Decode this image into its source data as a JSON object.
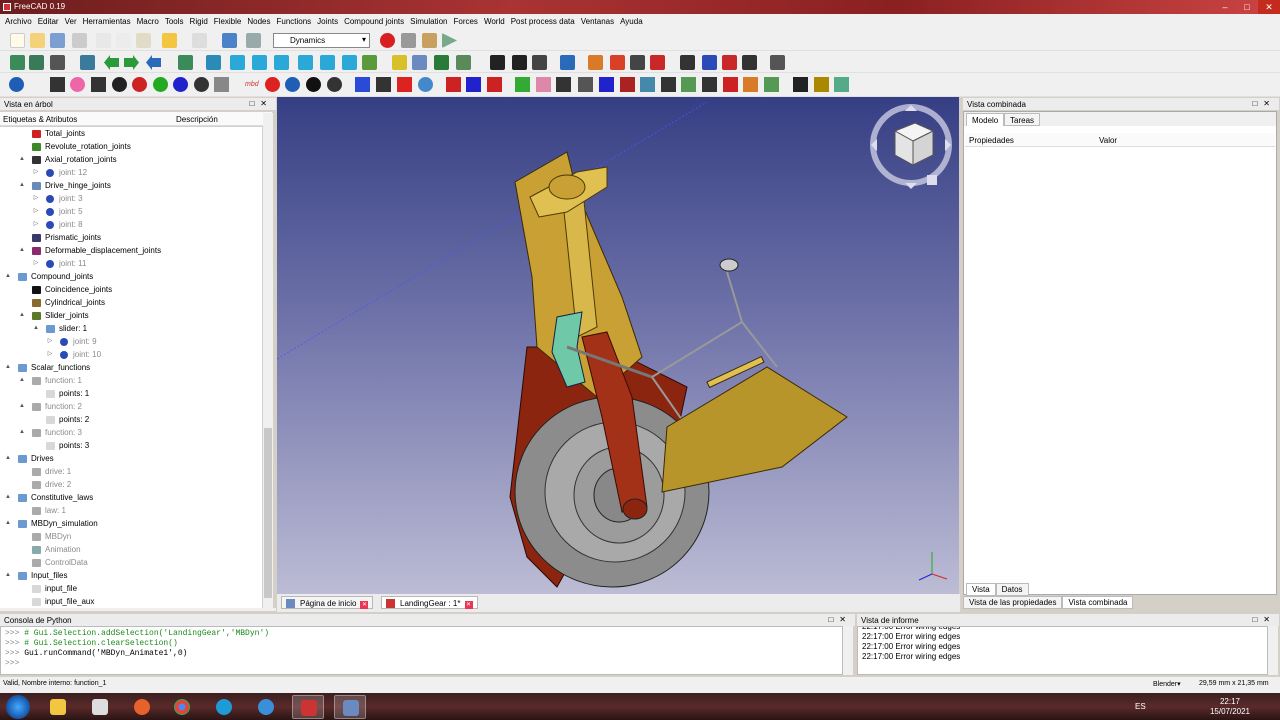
{
  "window": {
    "title": "FreeCAD 0.19"
  },
  "menu": [
    "Archivo",
    "Editar",
    "Ver",
    "Herramientas",
    "Macro",
    "Tools",
    "Rigid",
    "Flexible",
    "Nodes",
    "Functions",
    "Joints",
    "Compound joints",
    "Simulation",
    "Forces",
    "World",
    "Post process data",
    "Ventanas",
    "Ayuda"
  ],
  "toolbar": {
    "workbench": "Dynamics",
    "mbd_label": "mbd"
  },
  "tree_panel": {
    "title": "Vista en árbol",
    "col_labels": "Etiquetas & Atributos",
    "col_desc": "Descripción",
    "rows": [
      {
        "label": "Total_joints",
        "level": 3,
        "icon": "T",
        "arrow": "",
        "grey": false
      },
      {
        "label": "Revolute_rotation_joints",
        "level": 3,
        "icon": "green",
        "arrow": "",
        "grey": false
      },
      {
        "label": "Axial_rotation_joints",
        "level": 3,
        "icon": "dark",
        "arrow": "▲",
        "grey": false
      },
      {
        "label": "joint: 12",
        "level": 4,
        "icon": "joint",
        "arrow": "▷",
        "grey": true
      },
      {
        "label": "Drive_hinge_joints",
        "level": 3,
        "icon": "hinge",
        "arrow": "▲",
        "grey": false
      },
      {
        "label": "joint: 3",
        "level": 4,
        "icon": "joint",
        "arrow": "▷",
        "grey": true
      },
      {
        "label": "joint: 5",
        "level": 4,
        "icon": "joint",
        "arrow": "▷",
        "grey": true
      },
      {
        "label": "joint: 8",
        "level": 4,
        "icon": "joint",
        "arrow": "▷",
        "grey": true
      },
      {
        "label": "Prismatic_joints",
        "level": 3,
        "icon": "prism",
        "arrow": "",
        "grey": false
      },
      {
        "label": "Deformable_displacement_joints",
        "level": 3,
        "icon": "deform",
        "arrow": "▲",
        "grey": false
      },
      {
        "label": "joint: 11",
        "level": 4,
        "icon": "joint",
        "arrow": "▷",
        "grey": true
      },
      {
        "label": "Compound_joints",
        "level": 2,
        "icon": "folder",
        "arrow": "▲",
        "grey": false
      },
      {
        "label": "Coincidence_joints",
        "level": 3,
        "icon": "lock",
        "arrow": "",
        "grey": false
      },
      {
        "label": "Cylindrical_joints",
        "level": 3,
        "icon": "cyl",
        "arrow": "",
        "grey": false
      },
      {
        "label": "Slider_joints",
        "level": 3,
        "icon": "slider",
        "arrow": "▲",
        "grey": false
      },
      {
        "label": "slider: 1",
        "level": 4,
        "icon": "folder",
        "arrow": "▲",
        "grey": false
      },
      {
        "label": "joint: 9",
        "level": 5,
        "icon": "joint",
        "arrow": "▷",
        "grey": true
      },
      {
        "label": "joint: 10",
        "level": 5,
        "icon": "joint",
        "arrow": "▷",
        "grey": true
      },
      {
        "label": "Scalar_functions",
        "level": 2,
        "icon": "folder",
        "arrow": "▲",
        "grey": false
      },
      {
        "label": "function: 1",
        "level": 3,
        "icon": "fx",
        "arrow": "▲",
        "grey": true
      },
      {
        "label": "points: 1",
        "level": 4,
        "icon": "doc",
        "arrow": "",
        "grey": false
      },
      {
        "label": "function: 2",
        "level": 3,
        "icon": "fx",
        "arrow": "▲",
        "grey": true
      },
      {
        "label": "points: 2",
        "level": 4,
        "icon": "doc",
        "arrow": "",
        "grey": false
      },
      {
        "label": "function: 3",
        "level": 3,
        "icon": "fx",
        "arrow": "▲",
        "grey": true
      },
      {
        "label": "points: 3",
        "level": 4,
        "icon": "doc",
        "arrow": "",
        "grey": false
      },
      {
        "label": "Drives",
        "level": 2,
        "icon": "folder",
        "arrow": "▲",
        "grey": false
      },
      {
        "label": "drive: 1",
        "level": 3,
        "icon": "drive",
        "arrow": "",
        "grey": true
      },
      {
        "label": "drive: 2",
        "level": 3,
        "icon": "drive",
        "arrow": "",
        "grey": true
      },
      {
        "label": "Constitutive_laws",
        "level": 2,
        "icon": "folder",
        "arrow": "▲",
        "grey": false
      },
      {
        "label": "law: 1",
        "level": 3,
        "icon": "law",
        "arrow": "",
        "grey": true
      },
      {
        "label": "MBDyn_simulation",
        "level": 2,
        "icon": "folder",
        "arrow": "▲",
        "grey": false
      },
      {
        "label": "MBDyn",
        "level": 3,
        "icon": "mbdyn",
        "arrow": "",
        "grey": true
      },
      {
        "label": "Animation",
        "level": 3,
        "icon": "anim",
        "arrow": "",
        "grey": true
      },
      {
        "label": "ControlData",
        "level": 3,
        "icon": "ctrl",
        "arrow": "",
        "grey": true
      },
      {
        "label": "Input_files",
        "level": 2,
        "icon": "folder",
        "arrow": "▲",
        "grey": false
      },
      {
        "label": "input_file",
        "level": 3,
        "icon": "doc",
        "arrow": "",
        "grey": false
      },
      {
        "label": "input_file_aux",
        "level": 3,
        "icon": "doc",
        "arrow": "",
        "grey": false
      }
    ]
  },
  "doc_tabs": [
    {
      "label": "Página de inicio",
      "active": false
    },
    {
      "label": "LandingGear : 1*",
      "active": true
    }
  ],
  "combo_panel": {
    "title": "Vista combinada",
    "tabs": [
      "Modelo",
      "Tareas"
    ],
    "prop_col": "Propiedades",
    "val_col": "Valor",
    "view_tabs": [
      "Vista",
      "Datos"
    ],
    "bottom_tabs": [
      "Vista de las propiedades",
      "Vista combinada"
    ]
  },
  "python_console": {
    "title": "Consola de Python",
    "lines": [
      {
        "prompt": ">>> ",
        "text": "# Gui.Selection.addSelection('LandingGear','MBDyn')",
        "type": "comment"
      },
      {
        "prompt": ">>> ",
        "text": "# Gui.Selection.clearSelection()",
        "type": "comment"
      },
      {
        "prompt": ">>> ",
        "text": "Gui.runCommand('MBDyn_Animate1',0)",
        "type": "code"
      },
      {
        "prompt": ">>> ",
        "text": "",
        "type": "code"
      }
    ]
  },
  "report_view": {
    "title": "Vista de informe",
    "lines": [
      "22:17:00  Error wiring edges",
      "22:17:00  Error wiring edges",
      "22:17:00  Error wiring edges",
      "22:17:00  Error wiring edges"
    ]
  },
  "status": {
    "left": "Valid, Nombre interno: function_1",
    "nav": "Blender",
    "dims": "29,59 mm x 21,35 mm"
  },
  "taskbar": {
    "lang": "ES",
    "time": "22:17",
    "date": "15/07/2021"
  },
  "colors": {
    "accent": "#1e5eb4",
    "tree_select": "#cde8ff",
    "viewport_top": "#363f84",
    "viewport_bottom": "#bcbcd5",
    "body_gold": "#c8a033",
    "body_red": "#8b2510",
    "tire": "#8c8c8c"
  }
}
